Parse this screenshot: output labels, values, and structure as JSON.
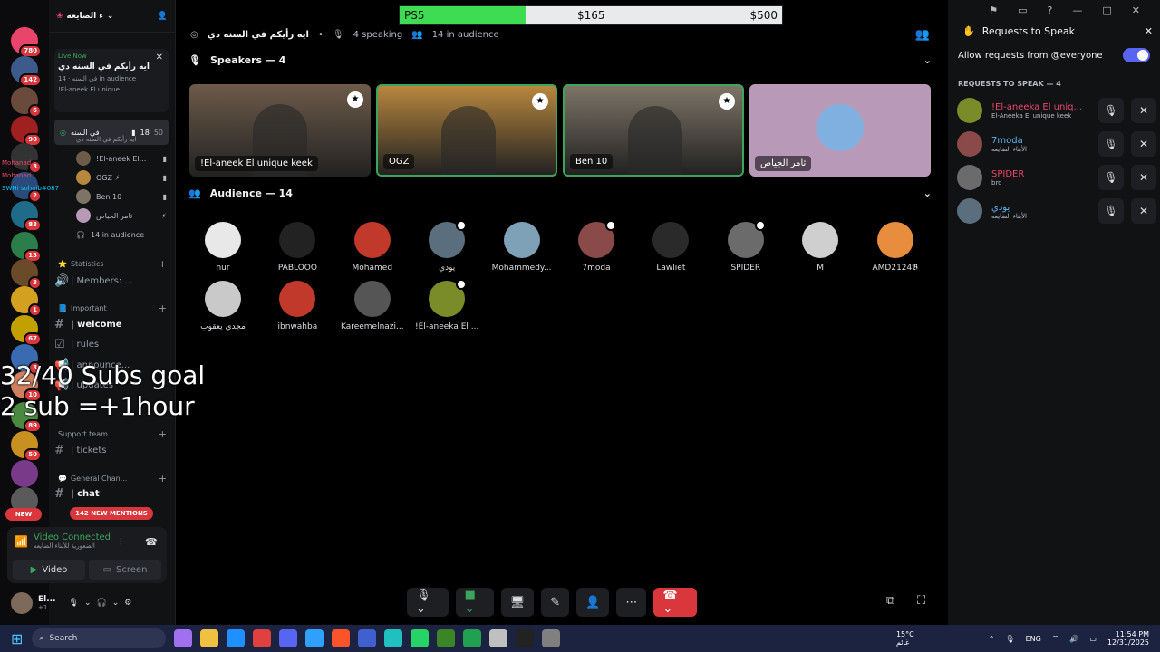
{
  "rail": {
    "badges": [
      "780",
      "142",
      "6",
      "90",
      "3",
      "2",
      "83",
      "13",
      "3",
      "1",
      "67",
      "3",
      "10",
      "89",
      "50"
    ],
    "new_label": "NEW"
  },
  "overlay_names": [
    "Mohanad",
    "Mohanad",
    "SWHi sohaib#087"
  ],
  "sidebar": {
    "server_name": "ء الضايعه",
    "live_now": "Live Now",
    "live_title": "ايه رأيكم في السنه دي",
    "live_sub": "في السنه",
    "live_sub_count": "14 in audience",
    "live_member": "!El-aneek El unique ...",
    "stage_channel": "في السنه",
    "stage_count_a": "18",
    "stage_count_b": "50",
    "stage_sub": "ايه رأيكم في السنه دي",
    "voice_members": [
      "!El-aneek El...",
      "OGZ ⚡",
      "Ben 10",
      "ثامر الجياص"
    ],
    "in_audience": "14 in audience",
    "statistics": "Statistics",
    "members": "| Members: ...",
    "important": "Important",
    "welcome": "| welcome",
    "rules": "| rules",
    "announce": "| announce...",
    "updates": "| updates",
    "support_team": "Support team",
    "tickets": "| tickets",
    "general": "General Chan...",
    "chat": "| chat",
    "mentions": "142 NEW MENTIONS",
    "vc_status": "Video Connected",
    "vc_sub": "الضعورية للأبناء الضايعه",
    "video_btn": "Video",
    "screen_btn": "Screen",
    "user_name": "El...",
    "user_status": "+1"
  },
  "overlay": {
    "line1": "32/40 Subs goal",
    "line2": "2 sub =+1hour"
  },
  "goal": {
    "label": "PS5",
    "current": "$165",
    "target": "$500",
    "progress": 0.33
  },
  "main": {
    "title": "ايه رأيكم في السنه دي",
    "speaking": "4 speaking",
    "audience_count": "14 in audience",
    "speakers_header": "Speakers — 4",
    "audience_header": "Audience — 14",
    "speakers": [
      {
        "name": "!El-aneek El unique keek",
        "color": "#6d5a49"
      },
      {
        "name": "OGZ",
        "color": "#b8873e"
      },
      {
        "name": "Ben 10",
        "color": "#7d7466"
      },
      {
        "name": "ثامر الجياص",
        "color": "#b89ab8"
      }
    ],
    "audience": [
      {
        "name": "nur",
        "color": "#e8e8e8"
      },
      {
        "name": "PABLOOO",
        "color": "#222"
      },
      {
        "name": "Mohamed",
        "color": "#c0392b"
      },
      {
        "name": "يودي",
        "color": "#5a6e7d"
      },
      {
        "name": "Mohammedy...",
        "color": "#7fa1b8"
      },
      {
        "name": "7moda",
        "color": "#8a4a4a"
      },
      {
        "name": "Lawliet",
        "color": "#2a2a2a"
      },
      {
        "name": "SPIDER",
        "color": "#6b6b6b"
      },
      {
        "name": "M",
        "color": "#cfcfcf"
      },
      {
        "name": "AMD2124𝕭",
        "color": "#e88c3d"
      },
      {
        "name": "مجدي يعقوب",
        "color": "#c9c9c9"
      },
      {
        "name": "ibnwahba",
        "color": "#c0392b"
      },
      {
        "name": "Kareemelnazi...",
        "color": "#555"
      },
      {
        "name": "!El-aneeka El ...",
        "color": "#7a8b2a"
      }
    ]
  },
  "right": {
    "title": "Requests to Speak",
    "allow_label": "Allow requests from @everyone",
    "requests_header": "REQUESTS TO SPEAK — 4",
    "requests": [
      {
        "name": "!El-aneeka El uniq...",
        "sub": "El-Aneeka El unique keek",
        "color": "#e9456b",
        "av": "#7a8b2a"
      },
      {
        "name": "7moda",
        "sub": "الأبناء الضايعه",
        "color": "#5ab3f0",
        "av": "#8a4a4a"
      },
      {
        "name": "SPIDER",
        "sub": "bro",
        "color": "#e9456b",
        "av": "#6b6b6b"
      },
      {
        "name": "يودي",
        "sub": "الأبناء الضايعه",
        "color": "#5ab3f0",
        "av": "#5a6e7d"
      }
    ]
  },
  "taskbar": {
    "search": "Search",
    "weather": "15°C",
    "weather_sub": "غائم",
    "lang": "ENG",
    "time": "11:54 PM",
    "date": "12/31/2025"
  }
}
